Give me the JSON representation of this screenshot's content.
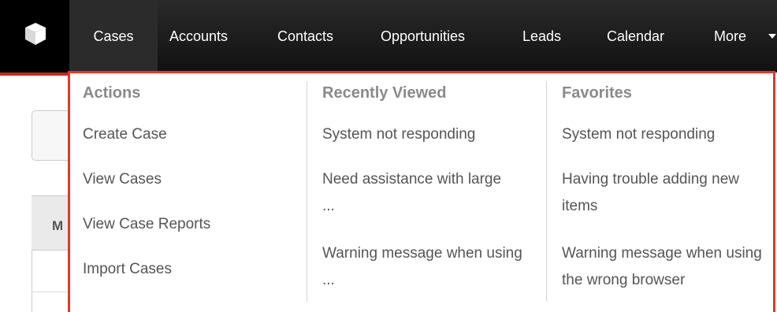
{
  "app": {
    "logo_icon": "cube-icon"
  },
  "nav": {
    "items": [
      {
        "label": "Cases",
        "active": true
      },
      {
        "label": "Accounts"
      },
      {
        "label": "Contacts"
      },
      {
        "label": "Opportunities"
      },
      {
        "label": "Leads"
      },
      {
        "label": "Calendar"
      },
      {
        "label": "More"
      }
    ],
    "more_icon": "caret-down-icon"
  },
  "background": {
    "table_header_fragment": "M"
  },
  "dropdown": {
    "actions": {
      "title": "Actions",
      "items": [
        "Create Case",
        "View Cases",
        "View Case Reports",
        "Import Cases"
      ]
    },
    "recently_viewed": {
      "title": "Recently Viewed",
      "items": [
        "System not responding",
        "Need assistance with large ...",
        "Warning message when using ..."
      ]
    },
    "favorites": {
      "title": "Favorites",
      "items": [
        "System not responding",
        "Having trouble adding new items",
        "Warning message when using the wrong browser"
      ]
    }
  },
  "colors": {
    "navbar": "#1a1a1a",
    "accent": "#e0382a",
    "link_text": "#555555",
    "section_title": "#8a8a8a"
  }
}
